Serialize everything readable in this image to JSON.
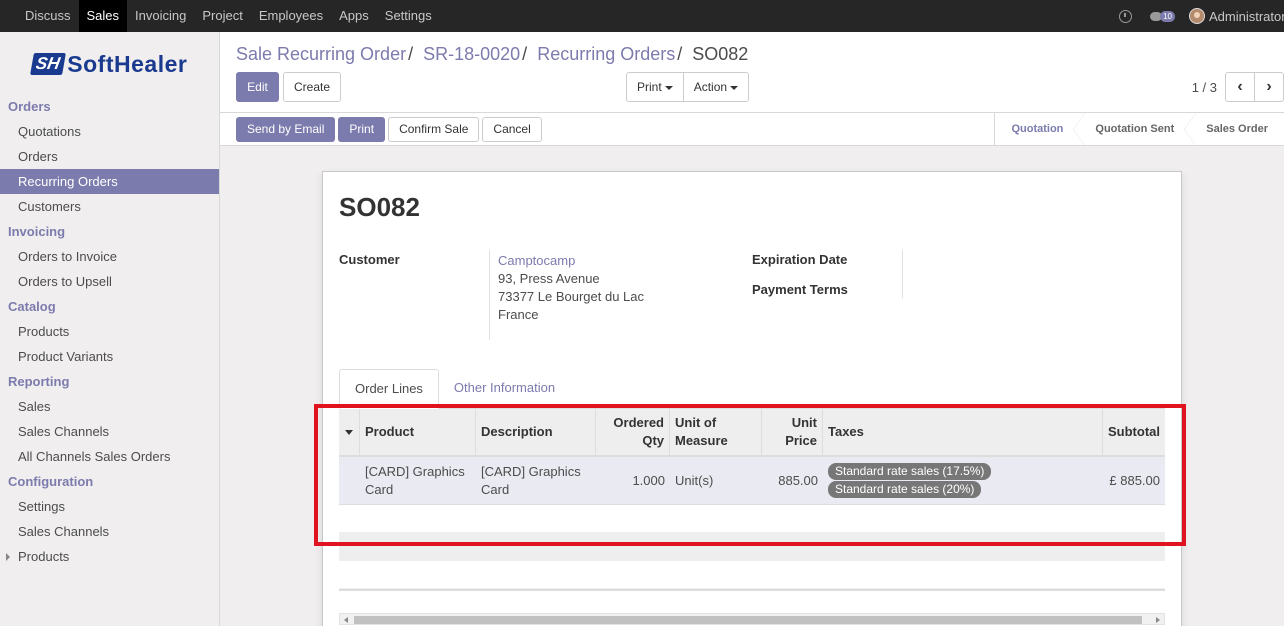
{
  "topbar": {
    "menu": [
      "Discuss",
      "Sales",
      "Invoicing",
      "Project",
      "Employees",
      "Apps",
      "Settings"
    ],
    "active": "Sales",
    "message_count": "10",
    "user": "Administrator"
  },
  "sidebar": {
    "logo_mark": "SH",
    "logo_text": "Soft",
    "logo_text2": "Healer",
    "sections": [
      {
        "title": "Orders",
        "items": [
          "Quotations",
          "Orders",
          "Recurring Orders",
          "Customers"
        ]
      },
      {
        "title": "Invoicing",
        "items": [
          "Orders to Invoice",
          "Orders to Upsell"
        ]
      },
      {
        "title": "Catalog",
        "items": [
          "Products",
          "Product Variants"
        ]
      },
      {
        "title": "Reporting",
        "items": [
          "Sales",
          "Sales Channels",
          "All Channels Sales Orders"
        ]
      },
      {
        "title": "Configuration",
        "items": [
          "Settings",
          "Sales Channels",
          "Products"
        ]
      }
    ],
    "active_item": "Recurring Orders"
  },
  "breadcrumb": {
    "items": [
      "Sale Recurring Order",
      "SR-18-0020",
      "Recurring Orders"
    ],
    "current": "SO082"
  },
  "buttons": {
    "edit": "Edit",
    "create": "Create",
    "print": "Print",
    "action": "Action"
  },
  "pager": {
    "value": "1 / 3"
  },
  "statusbar": {
    "actions": [
      "Send by Email",
      "Print",
      "Confirm Sale",
      "Cancel"
    ],
    "stages": [
      "Quotation",
      "Quotation Sent",
      "Sales Order"
    ],
    "active_stage": "Quotation"
  },
  "form": {
    "name": "SO082",
    "customer_label": "Customer",
    "customer_name": "Camptocamp",
    "address": [
      "93, Press Avenue",
      "73377 Le Bourget du Lac",
      "France"
    ],
    "expiration_label": "Expiration Date",
    "payment_terms_label": "Payment Terms"
  },
  "tabs": [
    "Order Lines",
    "Other Information"
  ],
  "order_lines": {
    "headers": {
      "product": "Product",
      "description": "Description",
      "qty1": "Ordered",
      "qty2": "Qty",
      "uom1": "Unit of",
      "uom2": "Measure",
      "price1": "Unit",
      "price2": "Price",
      "taxes": "Taxes",
      "subtotal": "Subtotal"
    },
    "rows": [
      {
        "product": "[CARD] Graphics Card",
        "description": "[CARD] Graphics Card",
        "qty": "1.000",
        "uom": "Unit(s)",
        "price": "885.00",
        "taxes": [
          "Standard rate sales (17.5%)",
          "Standard rate sales (20%)"
        ],
        "subtotal": "£ 885.00"
      }
    ]
  },
  "colors": {
    "primary": "#7c7bad",
    "highlight": "#e0141e",
    "topbar": "#262626"
  }
}
